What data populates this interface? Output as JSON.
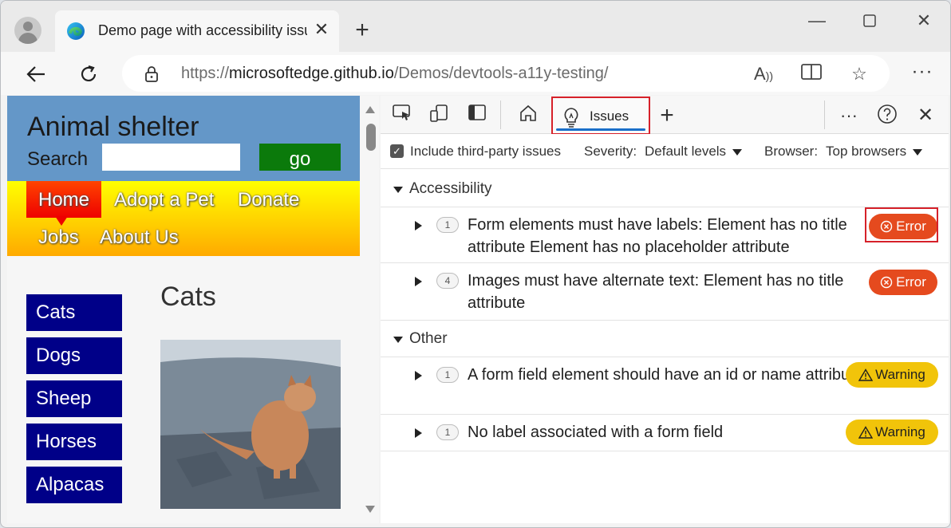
{
  "browser": {
    "tab_title": "Demo page with accessibility issues",
    "url_prefix": "https://",
    "url_host": "microsoftedge.github.io",
    "url_path": "/Demos/devtools-a11y-testing/"
  },
  "webpage": {
    "site_title": "Animal shelter",
    "search_label": "Search",
    "search_placeholder": "",
    "go_button": "go",
    "nav": [
      "Home",
      "Adopt a Pet",
      "Donate",
      "Jobs",
      "About Us"
    ],
    "sidebar": [
      "Cats",
      "Dogs",
      "Sheep",
      "Horses",
      "Alpacas"
    ],
    "heading": "Cats"
  },
  "devtools": {
    "issues_tab_label": "Issues",
    "include_third_party_label": "Include third-party issues",
    "include_third_party_checked": true,
    "severity_label": "Severity:",
    "severity_value": "Default levels",
    "browser_label": "Browser:",
    "browser_value": "Top browsers",
    "groups": [
      {
        "title": "Accessibility",
        "issues": [
          {
            "count": "1",
            "text": "Form elements must have labels: Element has no title attribute Element has no placeholder attribute",
            "severity": "Error"
          },
          {
            "count": "4",
            "text": "Images must have alternate text: Element has no title attribute",
            "severity": "Error"
          }
        ]
      },
      {
        "title": "Other",
        "issues": [
          {
            "count": "1",
            "text": "A form field element should have an id or name attribute",
            "severity": "Warning"
          },
          {
            "count": "1",
            "text": "No label associated with a form field",
            "severity": "Warning"
          }
        ]
      }
    ]
  },
  "colors": {
    "error": "#e54a1e",
    "warning": "#f1c40a",
    "highlight_frame": "#d6212a",
    "header_blue": "#6497c8",
    "go_green": "#0b7a0b",
    "sidebar_navy": "#000088"
  }
}
